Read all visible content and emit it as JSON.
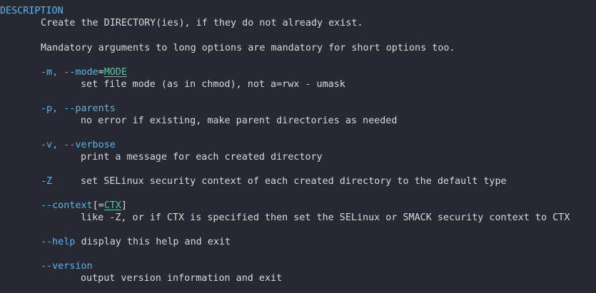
{
  "section_heading": "DESCRIPTION",
  "intro": {
    "line1": "Create the DIRECTORY(ies), if they do not already exist.",
    "line2": "Mandatory arguments to long options are mandatory for short options too."
  },
  "options": {
    "mode": {
      "flags": "-m, --mode",
      "eq": "=",
      "arg": "MODE",
      "desc": "set file mode (as in chmod), not a=rwx - umask"
    },
    "parents": {
      "flags": "-p, --parents",
      "desc": "no error if existing, make parent directories as needed"
    },
    "verbose": {
      "flags": "-v, --verbose",
      "desc": "print a message for each created directory"
    },
    "selinux": {
      "flag": "-Z",
      "desc": "set SELinux security context of each created directory to the default type"
    },
    "context": {
      "flag": "--context",
      "bracket_open": "[=",
      "arg": "CTX",
      "bracket_close": "]",
      "desc": "like -Z, or if CTX is specified then set the SELinux or SMACK security context to CTX"
    },
    "help": {
      "flag": "--help",
      "desc": "display this help and exit"
    },
    "version": {
      "flag": "--version",
      "desc": "output version information and exit"
    }
  },
  "colors": {
    "background": "#262931",
    "heading": "#58b5ee",
    "option": "#58b5ee",
    "argument": "#4fc9a6",
    "text": "#d7d9de"
  }
}
